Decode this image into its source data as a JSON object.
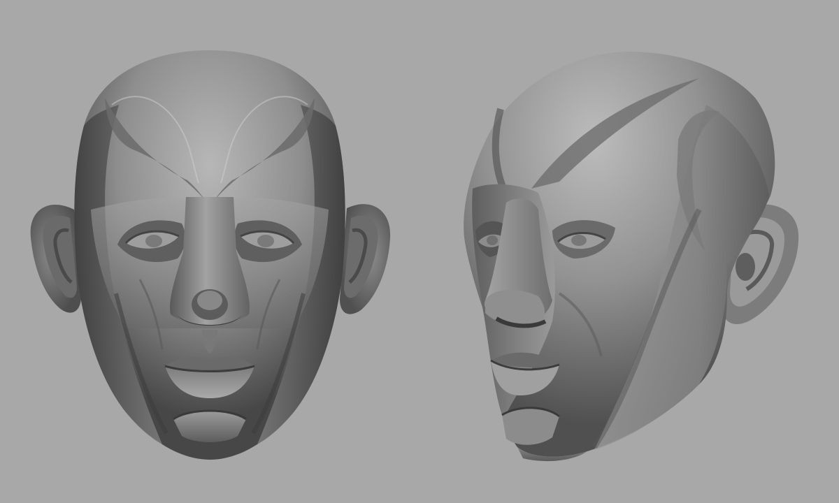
{
  "scene": {
    "background_color": "#a8a8a8",
    "subjects": [
      {
        "name": "head-front-view-icon"
      },
      {
        "name": "head-three-quarter-view-icon"
      }
    ]
  },
  "palette": {
    "clay_light": "#b4b4b4",
    "clay_mid": "#8a8a8a",
    "clay_dark": "#5a5a5a",
    "clay_shadow": "#3a3a3a"
  }
}
